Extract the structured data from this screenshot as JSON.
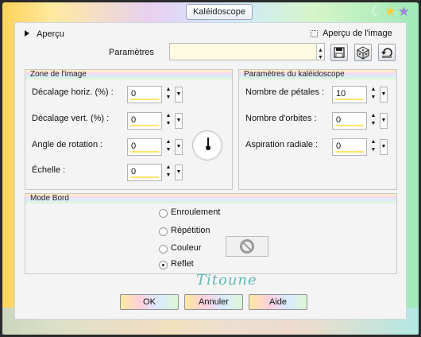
{
  "window": {
    "title": "Kaléidoscope"
  },
  "top": {
    "apercu_toggle": "Aperçu",
    "apercu_image": "Aperçu de l'image",
    "parametres_label": "Paramètres",
    "parametres_value": ""
  },
  "zone_image": {
    "title": "Zone de l'image",
    "fields": [
      {
        "label": "Décalage horiz. (%) :",
        "value": "0"
      },
      {
        "label": "Décalage vert. (%) :",
        "value": "0"
      },
      {
        "label": "Angle de rotation :",
        "value": "0"
      },
      {
        "label": "Échelle :",
        "value": "0"
      }
    ]
  },
  "params_kaleido": {
    "title": "Paramètres du kaléidoscope",
    "fields": [
      {
        "label": "Nombre de pétales :",
        "value": "10"
      },
      {
        "label": "Nombre d'orbites :",
        "value": "0"
      },
      {
        "label": "Aspiration radiale :",
        "value": "0"
      }
    ]
  },
  "mode_bord": {
    "title": "Mode Bord",
    "options": [
      "Enroulement",
      "Répétition",
      "Couleur",
      "Reflet"
    ],
    "selected": "Reflet"
  },
  "signature": "Titoune",
  "buttons": {
    "ok": "OK",
    "cancel": "Annuler",
    "help": "Aide"
  }
}
